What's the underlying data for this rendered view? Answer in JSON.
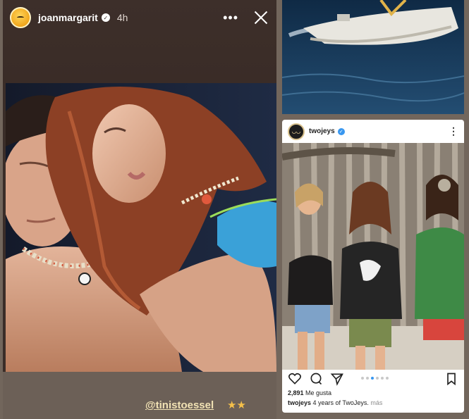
{
  "story": {
    "username": "joanmargarit",
    "time_ago": "4h",
    "mention": "@tinistoessel",
    "stars": "★★"
  },
  "post": {
    "username": "twojeys",
    "likes_count": "2,891",
    "likes_label": "Me gusta",
    "caption_user": "twojeys",
    "caption_text": "4 years of TwoJeys.",
    "caption_more": "más",
    "carousel": {
      "total": 6,
      "active": 3
    }
  },
  "colors": {
    "story_bg": "#3a2d28",
    "mention": "#f1e2b4",
    "stars": "#f5c04a",
    "verified_blue": "#3897f0"
  }
}
